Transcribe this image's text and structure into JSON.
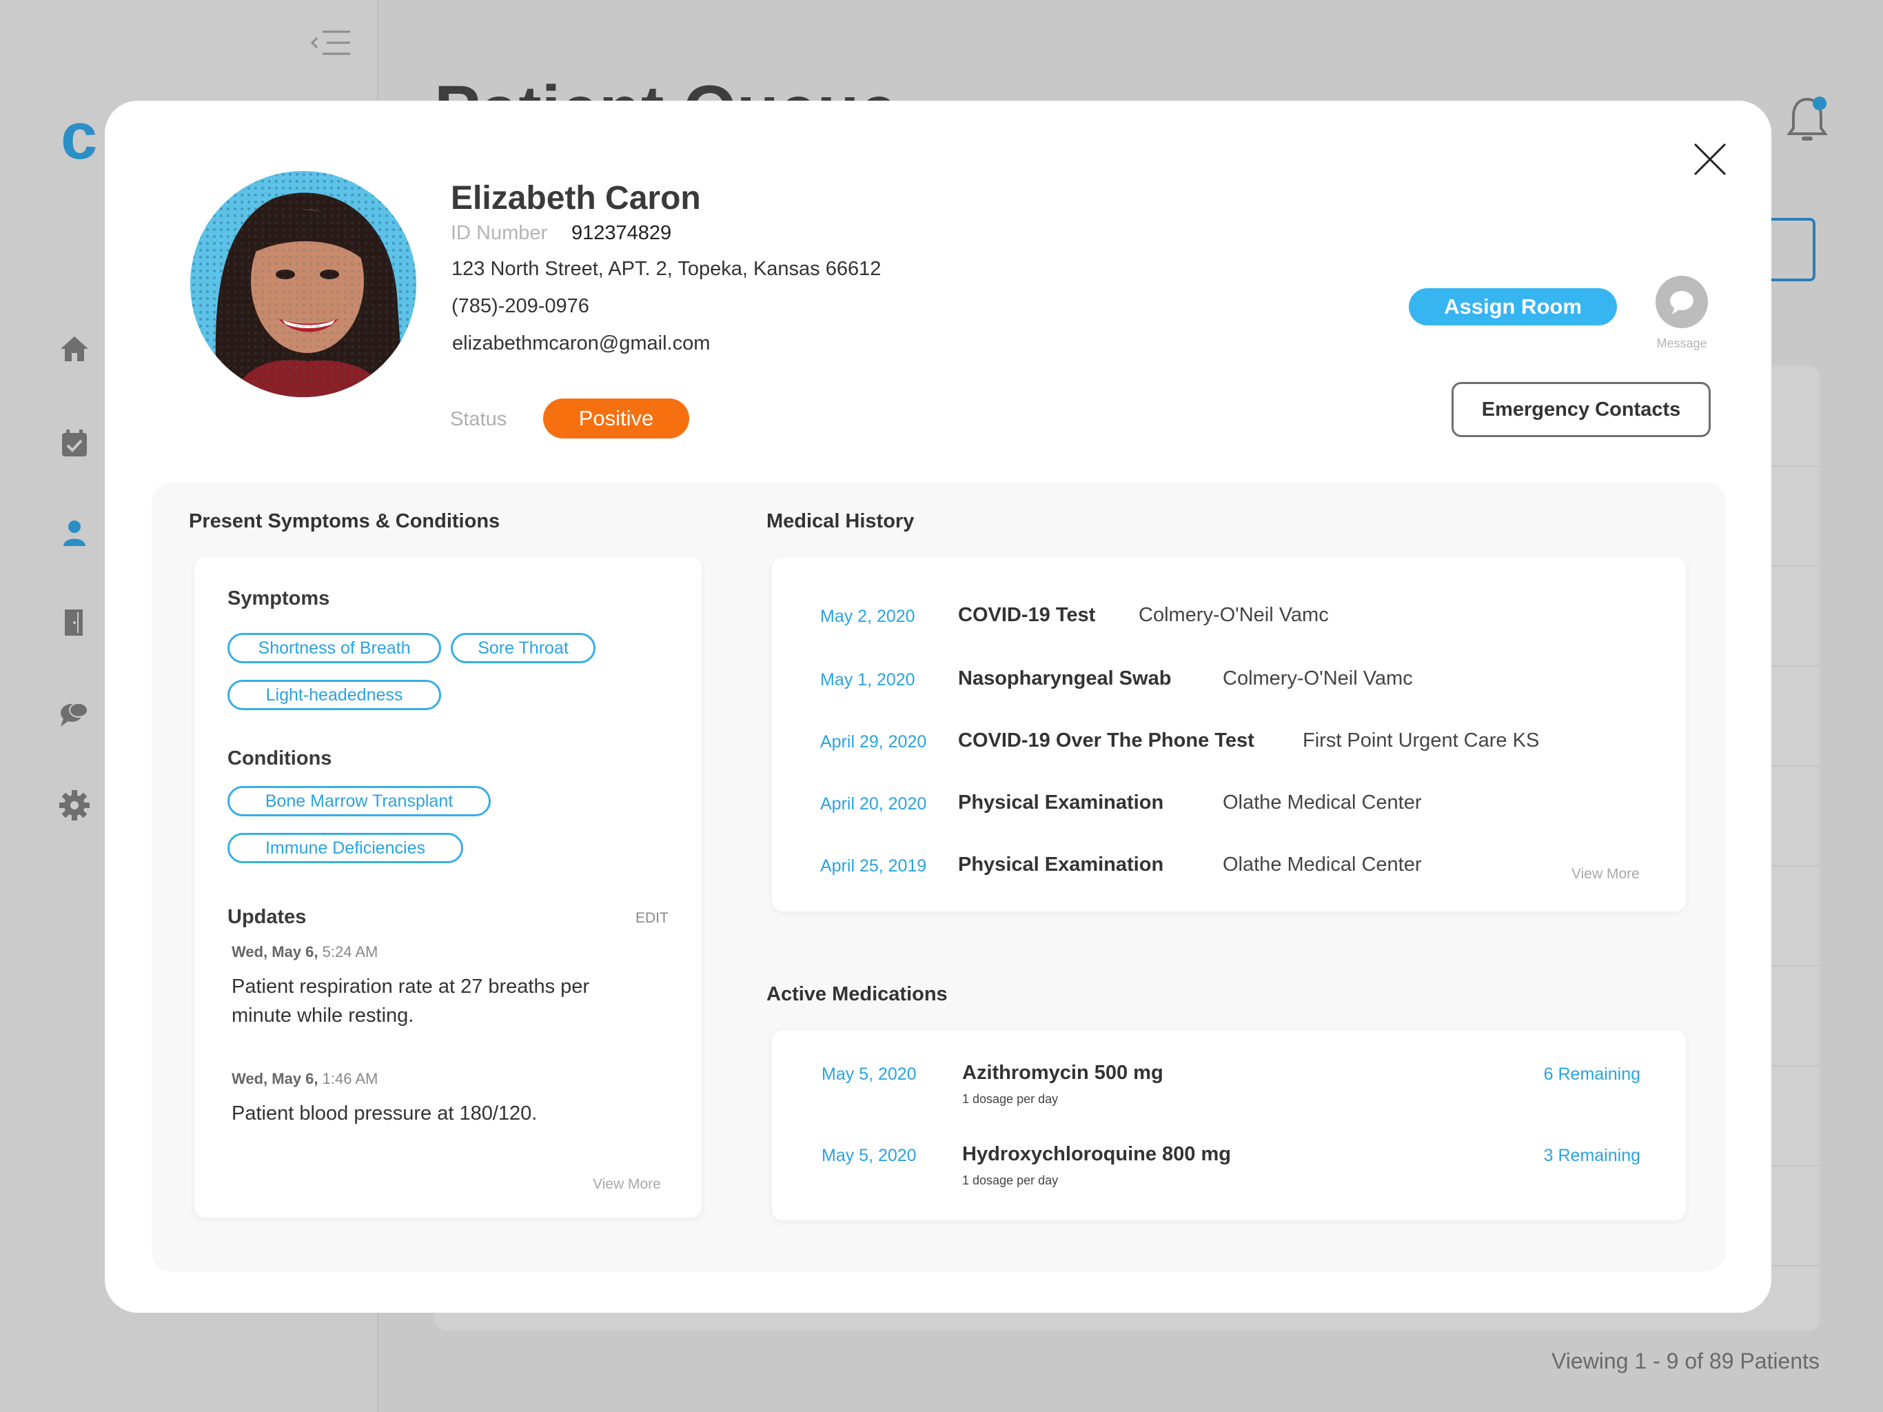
{
  "background": {
    "logo": "c",
    "page_title": "Patient Queue",
    "footer": "Viewing 1 - 9 of 89 Patients",
    "nav": [
      "home-icon",
      "calendar-check-icon",
      "patient-icon",
      "door-icon",
      "chat-icon",
      "gear-icon"
    ]
  },
  "patient": {
    "name": "Elizabeth Caron",
    "id_label": "ID Number",
    "id_value": "912374829",
    "address": "123 North Street, APT. 2, Topeka, Kansas 66612",
    "phone": "(785)-209-0976",
    "email": "elizabethmcaron@gmail.com",
    "status_label": "Status",
    "status_value": "Positive"
  },
  "actions": {
    "assign_room": "Assign Room",
    "message": "Message",
    "emergency_contacts": "Emergency Contacts"
  },
  "symptoms_section": {
    "title": "Present Symptoms & Conditions",
    "symptoms_title": "Symptoms",
    "symptoms": [
      "Shortness of Breath",
      "Sore Throat",
      "Light-headedness"
    ],
    "conditions_title": "Conditions",
    "conditions": [
      "Bone Marrow Transplant",
      "Immune Deficiencies"
    ],
    "updates_title": "Updates",
    "edit_label": "EDIT",
    "updates": [
      {
        "day": "Wed, May 6,",
        "time": "5:24 AM",
        "text": "Patient respiration rate at 27 breaths per minute while resting."
      },
      {
        "day": "Wed, May 6,",
        "time": "1:46 AM",
        "text": "Patient blood pressure at 180/120."
      }
    ],
    "view_more": "View More"
  },
  "medical_history": {
    "title": "Medical History",
    "entries": [
      {
        "date": "May 2, 2020",
        "test": "COVID-19 Test",
        "place": "Colmery-O'Neil Vamc"
      },
      {
        "date": "May 1, 2020",
        "test": "Nasopharyngeal Swab",
        "place": "Colmery-O'Neil Vamc"
      },
      {
        "date": "April 29, 2020",
        "test": "COVID-19 Over The Phone Test",
        "place": "First Point Urgent Care KS"
      },
      {
        "date": "April 20, 2020",
        "test": "Physical Examination",
        "place": "Olathe Medical Center"
      },
      {
        "date": "April 25, 2019",
        "test": "Physical Examination",
        "place": "Olathe Medical Center"
      }
    ],
    "view_more": "View More"
  },
  "medications": {
    "title": "Active Medications",
    "entries": [
      {
        "date": "May 5, 2020",
        "name": "Azithromycin 500 mg",
        "dosage": "1 dosage per day",
        "remaining": "6 Remaining"
      },
      {
        "date": "May 5, 2020",
        "name": "Hydroxychloroquine 800 mg",
        "dosage": "1 dosage per day",
        "remaining": "3 Remaining"
      }
    ]
  },
  "colors": {
    "accent": "#37b5f1",
    "status_positive": "#f7700f",
    "logo": "#2b8fc6"
  }
}
